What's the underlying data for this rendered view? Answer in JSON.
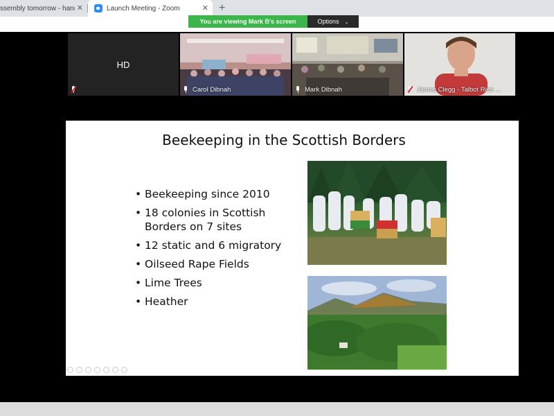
{
  "browser": {
    "tabs": [
      {
        "title": "ssembly tomorrow - hanna",
        "close": "✕"
      },
      {
        "title": "Launch Meeting - Zoom",
        "close": "✕"
      }
    ],
    "new_tab": "+"
  },
  "zoom": {
    "share_banner": "You are viewing Mark B's screen",
    "options_label": "Options",
    "options_chevron": "⌄",
    "participants": [
      {
        "name": "",
        "initials": "HD",
        "muted": true
      },
      {
        "name": "Carol Dibnah",
        "muted": false
      },
      {
        "name": "Mark Dibnah",
        "muted": false
      },
      {
        "name": "James Clegg - Talbot Rice ...",
        "muted": true
      }
    ]
  },
  "slide": {
    "title": "Beekeeping in the Scottish Borders",
    "bullets": [
      "Beekeeping since 2010",
      "18 colonies in Scottish Borders on 7 sites",
      "12 static and 6 migratory",
      "Oilseed Rape Fields",
      "Lime Trees",
      "Heather"
    ]
  },
  "colors": {
    "share_banner_bg": "#3cb54a",
    "zoom_blue": "#2d8cff",
    "mute_red": "#e02828"
  }
}
